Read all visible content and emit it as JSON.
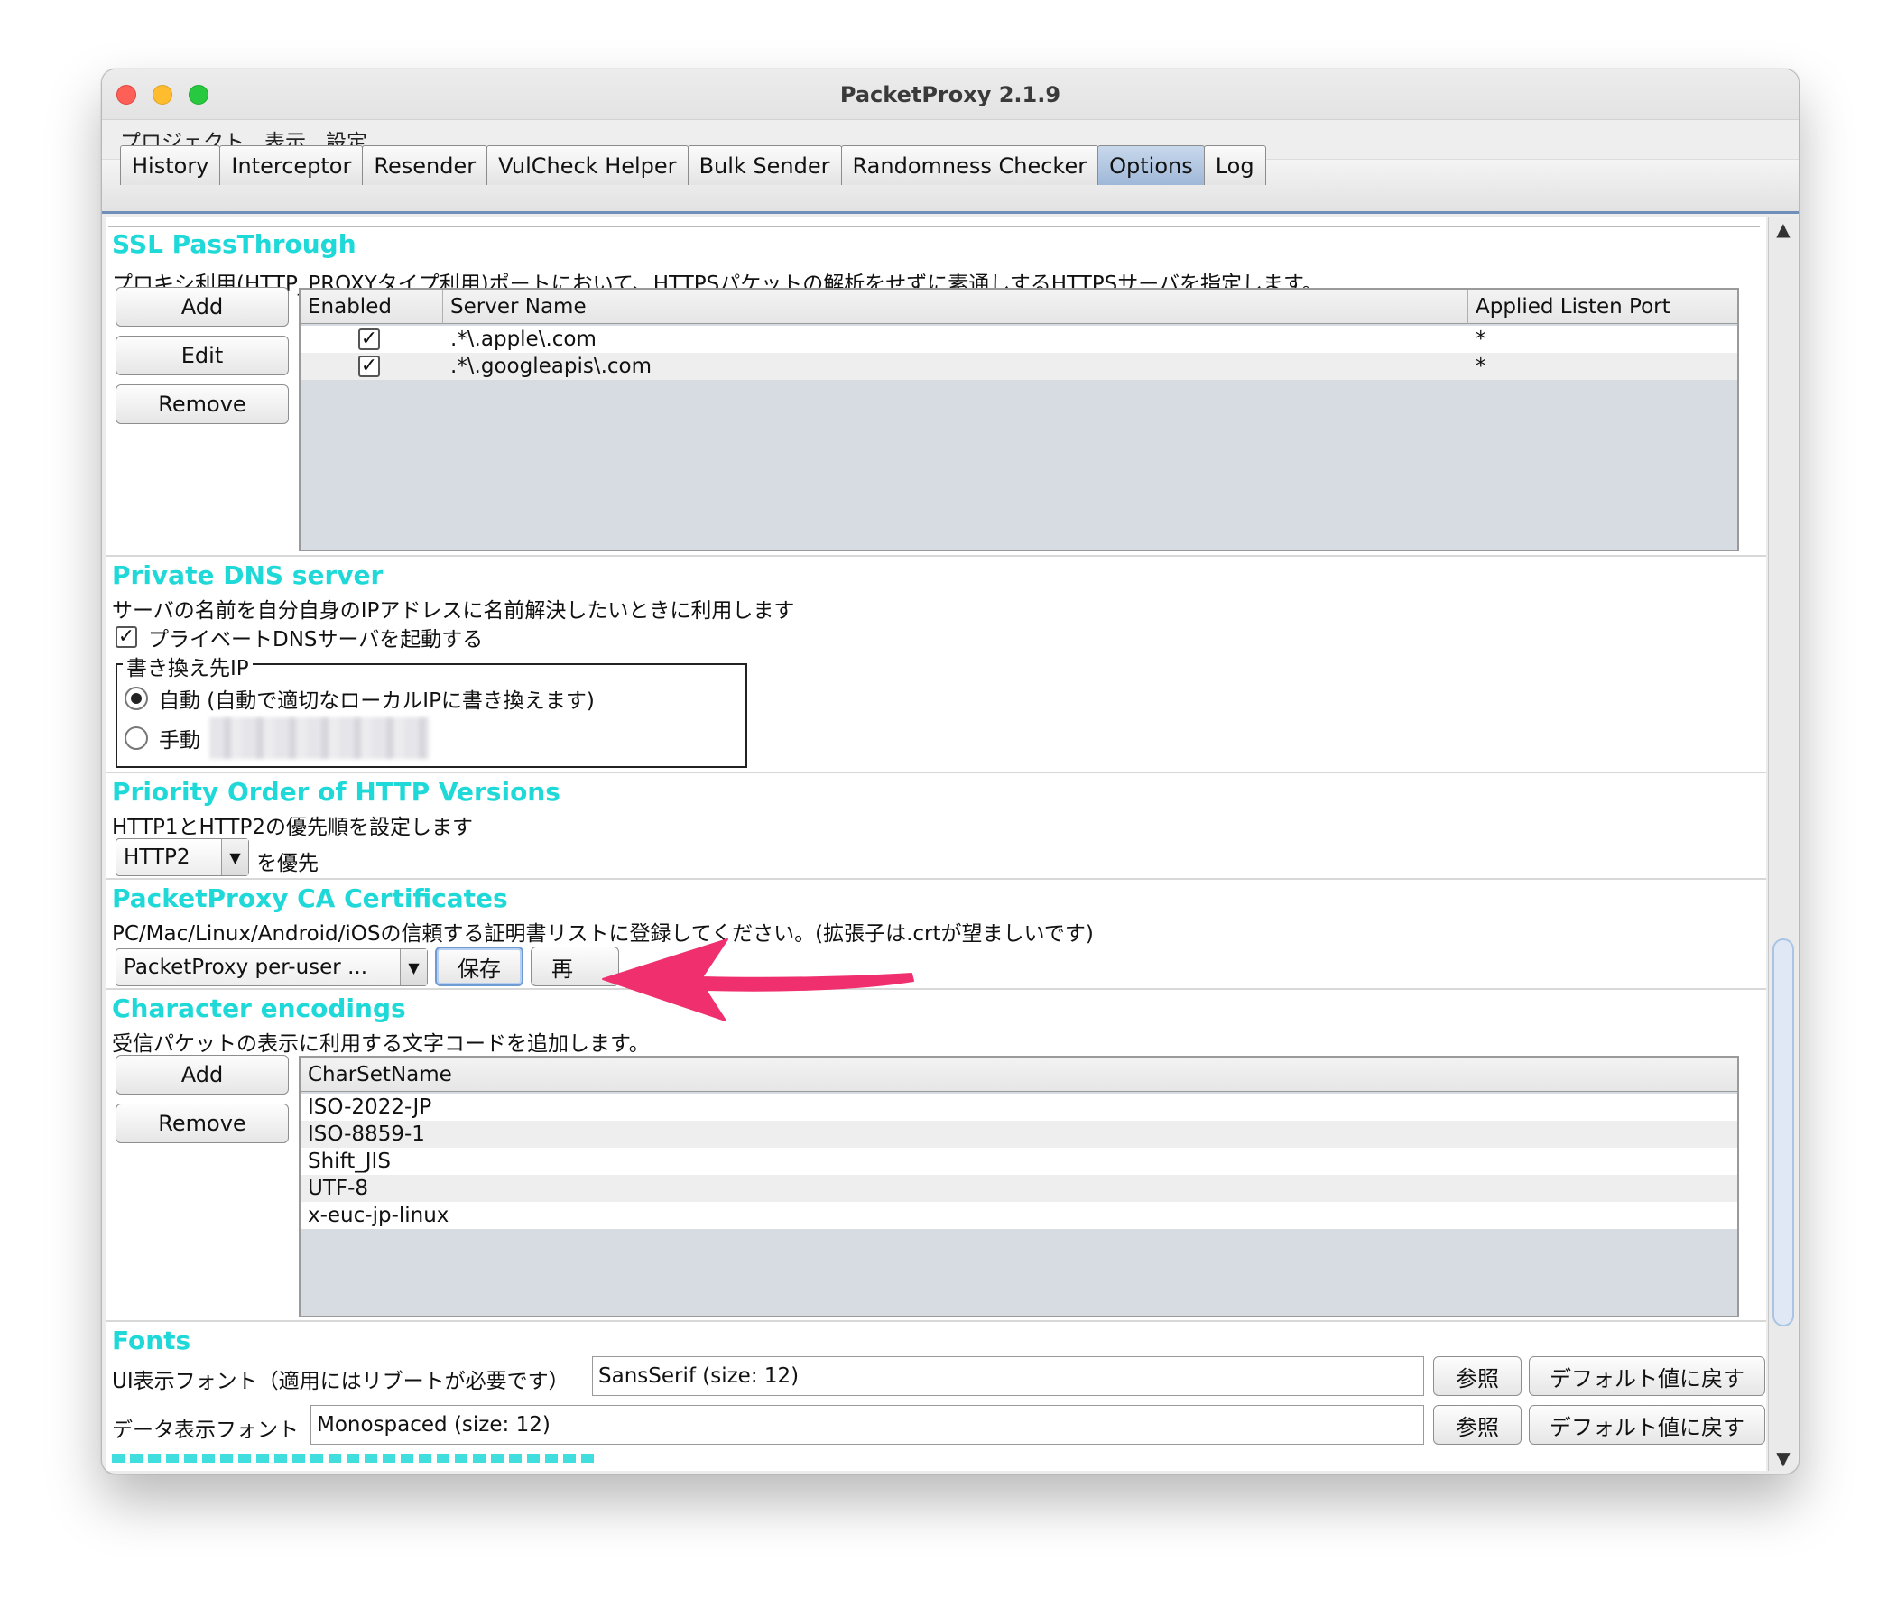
{
  "window": {
    "title": "PacketProxy 2.1.9"
  },
  "menu": [
    "プロジェクト",
    "表示",
    "設定"
  ],
  "tabs": [
    {
      "label": "History",
      "active": false
    },
    {
      "label": "Interceptor",
      "active": false
    },
    {
      "label": "Resender",
      "active": false
    },
    {
      "label": "VulCheck Helper",
      "active": false
    },
    {
      "label": "Bulk Sender",
      "active": false
    },
    {
      "label": "Randomness Checker",
      "active": false
    },
    {
      "label": "Options",
      "active": true
    },
    {
      "label": "Log",
      "active": false
    }
  ],
  "ssl": {
    "title": "SSL PassThrough",
    "desc": "プロキシ利用(HTTP_PROXYタイプ利用)ポートにおいて、HTTPSパケットの解析をせずに素通しするHTTPSサーバを指定します。",
    "buttons": {
      "add": "Add",
      "edit": "Edit",
      "remove": "Remove"
    },
    "columns": {
      "enabled": "Enabled",
      "server": "Server Name",
      "port": "Applied Listen Port"
    },
    "rows": [
      {
        "check": "✓",
        "server": ".*\\.apple\\.com",
        "port": "*"
      },
      {
        "check": "✓",
        "server": ".*\\.googleapis\\.com",
        "port": "*"
      }
    ]
  },
  "dns": {
    "title": "Private DNS server",
    "desc": "サーバの名前を自分自身のIPアドレスに名前解決したいときに利用します",
    "check": "✓",
    "enable_label": "プライベートDNSサーバを起動する",
    "group_label": "書き換え先IP",
    "auto_label": "自動 (自動で適切なローカルIPに書き換えます)",
    "manual_label": "手動"
  },
  "http": {
    "title": "Priority Order of HTTP Versions",
    "desc": "HTTP1とHTTP2の優先順を設定します",
    "selected": "HTTP2",
    "suffix": "を優先"
  },
  "ca": {
    "title": "PacketProxy CA Certificates",
    "desc": "PC/Mac/Linux/Android/iOSの信頼する証明書リストに登録してください。(拡張子は.crtが望ましいです)",
    "selected": "PacketProxy per-user ...",
    "save": "保存",
    "regen": "再"
  },
  "charset": {
    "title": "Character encodings",
    "desc": "受信パケットの表示に利用する文字コードを追加します。",
    "buttons": {
      "add": "Add",
      "remove": "Remove"
    },
    "column": "CharSetName",
    "rows": [
      "ISO-2022-JP",
      "ISO-8859-1",
      "Shift_JIS",
      "UTF-8",
      "x-euc-jp-linux"
    ]
  },
  "fonts": {
    "title": "Fonts",
    "ui_label": "UI表示フォント（適用にはリブートが必要です）",
    "ui_value": "SansSerif (size: 12)",
    "data_label": "データ表示フォント",
    "data_value": "Monospaced (size: 12)",
    "browse": "参照",
    "reset": "デフォルト値に戻す"
  },
  "colors": {
    "section_title": "#1fd8d8",
    "annotation_arrow": "#f0306e",
    "active_tab": "#a9c1df"
  },
  "icons": {
    "scroll_up": "▲",
    "scroll_down": "▼",
    "combo_arrow": "▼"
  }
}
